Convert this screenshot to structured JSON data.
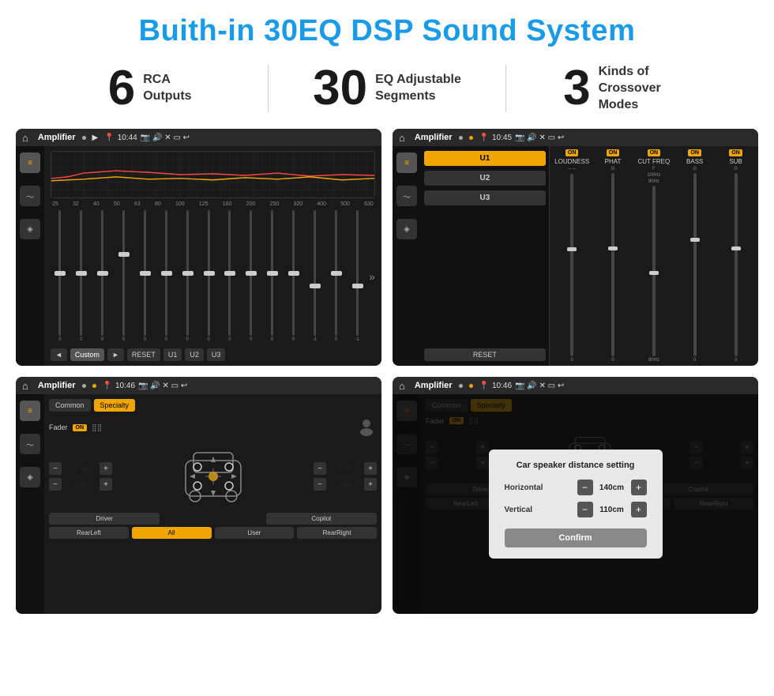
{
  "page": {
    "title": "Buith-in 30EQ DSP Sound System"
  },
  "stats": [
    {
      "number": "6",
      "label": "RCA\nOutputs"
    },
    {
      "number": "30",
      "label": "EQ Adjustable\nSegments"
    },
    {
      "number": "3",
      "label": "Kinds of\nCrossover Modes"
    }
  ],
  "screens": {
    "top_left": {
      "status_bar": {
        "app": "Amplifier",
        "time": "10:44"
      },
      "freq_labels": [
        "25",
        "32",
        "40",
        "50",
        "63",
        "80",
        "100",
        "125",
        "160",
        "200",
        "250",
        "320",
        "400",
        "500",
        "630"
      ],
      "slider_values": [
        "0",
        "0",
        "0",
        "5",
        "0",
        "0",
        "0",
        "0",
        "0",
        "0",
        "0",
        "0",
        "-1",
        "0",
        "-1"
      ],
      "buttons": [
        "◄",
        "Custom",
        "►",
        "RESET",
        "U1",
        "U2",
        "U3"
      ]
    },
    "top_right": {
      "status_bar": {
        "app": "Amplifier",
        "time": "10:45"
      },
      "presets": [
        "U1",
        "U2",
        "U3"
      ],
      "channels": [
        {
          "label": "LOUDNESS",
          "on": true
        },
        {
          "label": "PHAT",
          "on": true
        },
        {
          "label": "CUT FREQ",
          "on": true
        },
        {
          "label": "BASS",
          "on": true
        },
        {
          "label": "SUB",
          "on": true
        }
      ],
      "buttons": [
        "RESET"
      ]
    },
    "bottom_left": {
      "status_bar": {
        "app": "Amplifier",
        "time": "10:46"
      },
      "tabs": [
        "Common",
        "Specialty"
      ],
      "active_tab": "Specialty",
      "fader_label": "Fader",
      "fader_on": true,
      "db_values": [
        "0 dB",
        "0 dB",
        "0 dB",
        "0 dB"
      ],
      "bottom_buttons": [
        "Driver",
        "RearLeft",
        "All",
        "User",
        "RearRight",
        "Copilot"
      ]
    },
    "bottom_right": {
      "status_bar": {
        "app": "Amplifier",
        "time": "10:46"
      },
      "tabs": [
        "Common",
        "Specialty"
      ],
      "active_tab": "Specialty",
      "fader_on": true,
      "dialog": {
        "title": "Car speaker distance setting",
        "fields": [
          {
            "label": "Horizontal",
            "value": "140cm"
          },
          {
            "label": "Vertical",
            "value": "110cm"
          }
        ],
        "confirm_label": "Confirm"
      },
      "db_values": [
        "0 dB",
        "0 dB"
      ],
      "bottom_buttons": [
        "Driver",
        "RearLeft",
        "All",
        "User",
        "RearRight",
        "Copilot"
      ]
    }
  }
}
